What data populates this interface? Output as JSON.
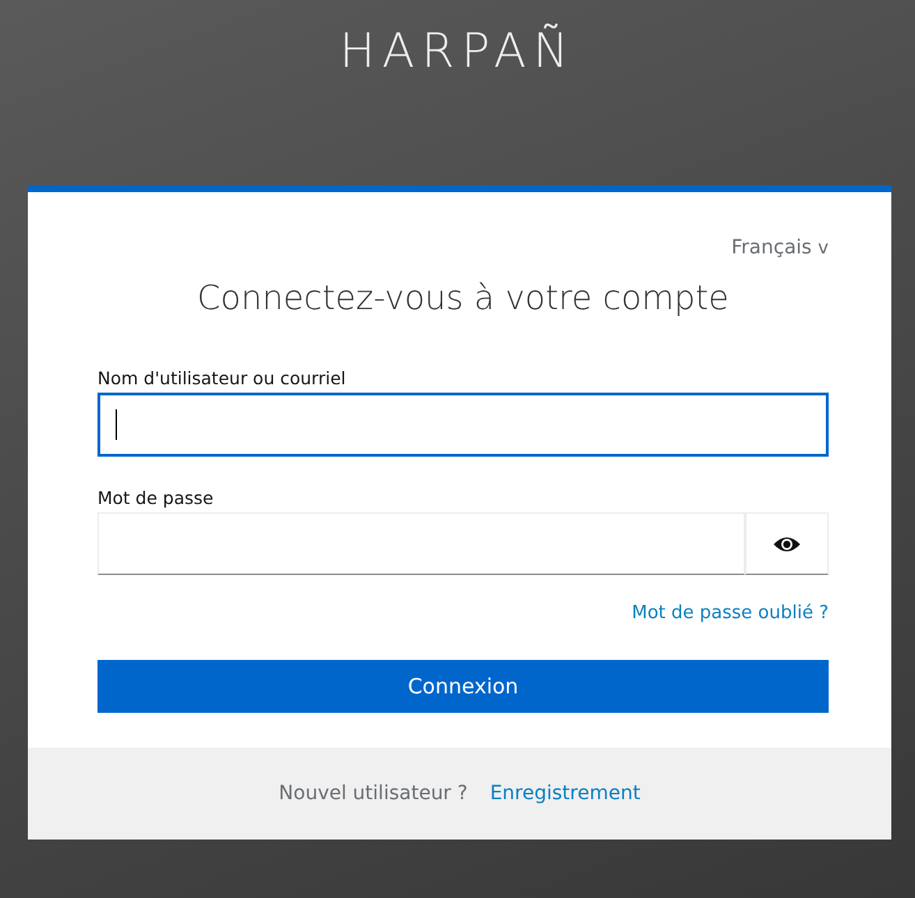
{
  "brand": "HARPAÑ",
  "language": {
    "label": "Français",
    "caret": "v"
  },
  "title": "Connectez-vous à votre compte",
  "fields": [
    {
      "label": "Nom d'utilisateur ou courriel",
      "kind": "text",
      "focused": true
    },
    {
      "label": "Mot de passe",
      "kind": "password",
      "focused": false
    }
  ],
  "forgot_link": "Mot de passe oublié ?",
  "submit": "Connexion",
  "footer": {
    "text": "Nouvel utilisateur ?",
    "link": "Enregistrement"
  }
}
